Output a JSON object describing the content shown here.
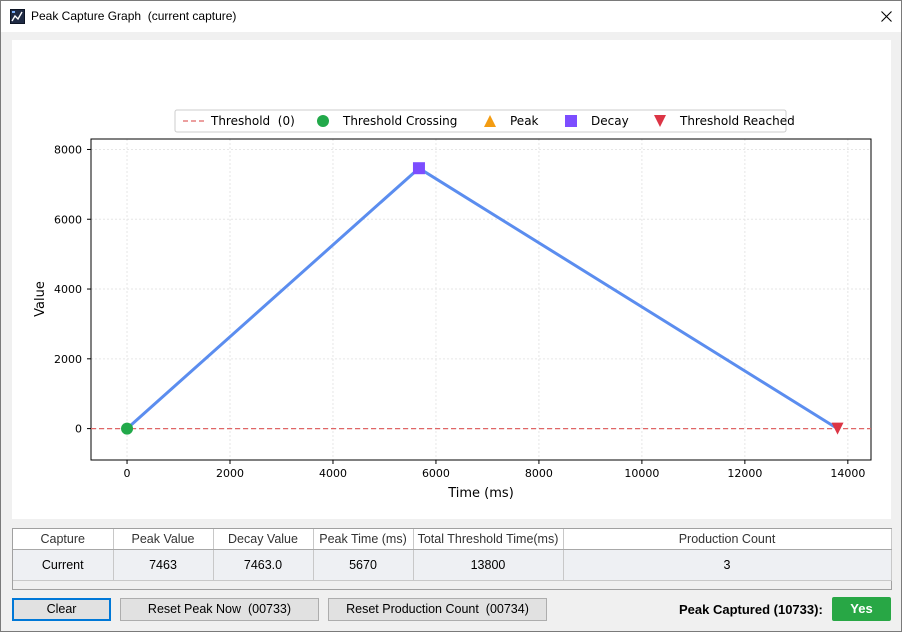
{
  "window": {
    "title": "Peak Capture Graph  (current capture)",
    "icon": "chart-app-icon",
    "close_icon": "close-icon"
  },
  "chart_data": {
    "type": "line",
    "title": "",
    "xlabel": "Time (ms)",
    "ylabel": "Value",
    "xlim": [
      -700,
      14450
    ],
    "ylim": [
      -900,
      8300
    ],
    "grid": true,
    "legend_placement": "top-center",
    "x_ticks": [
      0,
      2000,
      4000,
      6000,
      8000,
      10000,
      12000,
      14000
    ],
    "y_ticks": [
      0,
      2000,
      4000,
      6000,
      8000
    ],
    "series": [
      {
        "name": "",
        "color": "#5b8def",
        "points": [
          {
            "x": 0,
            "y": 0
          },
          {
            "x": 5670,
            "y": 7463
          },
          {
            "x": 13800,
            "y": 0
          }
        ]
      }
    ],
    "threshold": {
      "value": 0,
      "color": "#e06666"
    },
    "markers": [
      {
        "kind": "threshold-crossing",
        "shape": "circle",
        "color": "#22a94a",
        "x": 0,
        "y": 0
      },
      {
        "kind": "decay",
        "shape": "square",
        "color": "#7c4dff",
        "x": 5670,
        "y": 7463
      },
      {
        "kind": "threshold-reached",
        "shape": "triangle-down",
        "color": "#dc3545",
        "x": 13800,
        "y": 0
      }
    ],
    "legend": [
      {
        "label": "Threshold  (0)",
        "shape": "dashed-line",
        "color": "#e06666"
      },
      {
        "label": "Threshold Crossing",
        "shape": "circle",
        "color": "#22a94a"
      },
      {
        "label": "Peak",
        "shape": "triangle-up",
        "color": "#f39c12"
      },
      {
        "label": "Decay",
        "shape": "square",
        "color": "#7c4dff"
      },
      {
        "label": "Threshold Reached",
        "shape": "triangle-down",
        "color": "#dc3545"
      }
    ]
  },
  "table": {
    "columns": [
      "Capture",
      "Peak Value",
      "Decay Value",
      "Peak Time (ms)",
      "Total Threshold Time(ms)",
      "Production Count"
    ],
    "rows": [
      [
        "Current",
        "7463",
        "7463.0",
        "5670",
        "13800",
        "3"
      ]
    ]
  },
  "buttons": {
    "clear": "Clear",
    "reset_peak": "Reset Peak Now  (00733)",
    "reset_production": "Reset Production Count  (00734)"
  },
  "status": {
    "label": "Peak Captured (10733):",
    "value": "Yes",
    "color": "#28a745"
  }
}
